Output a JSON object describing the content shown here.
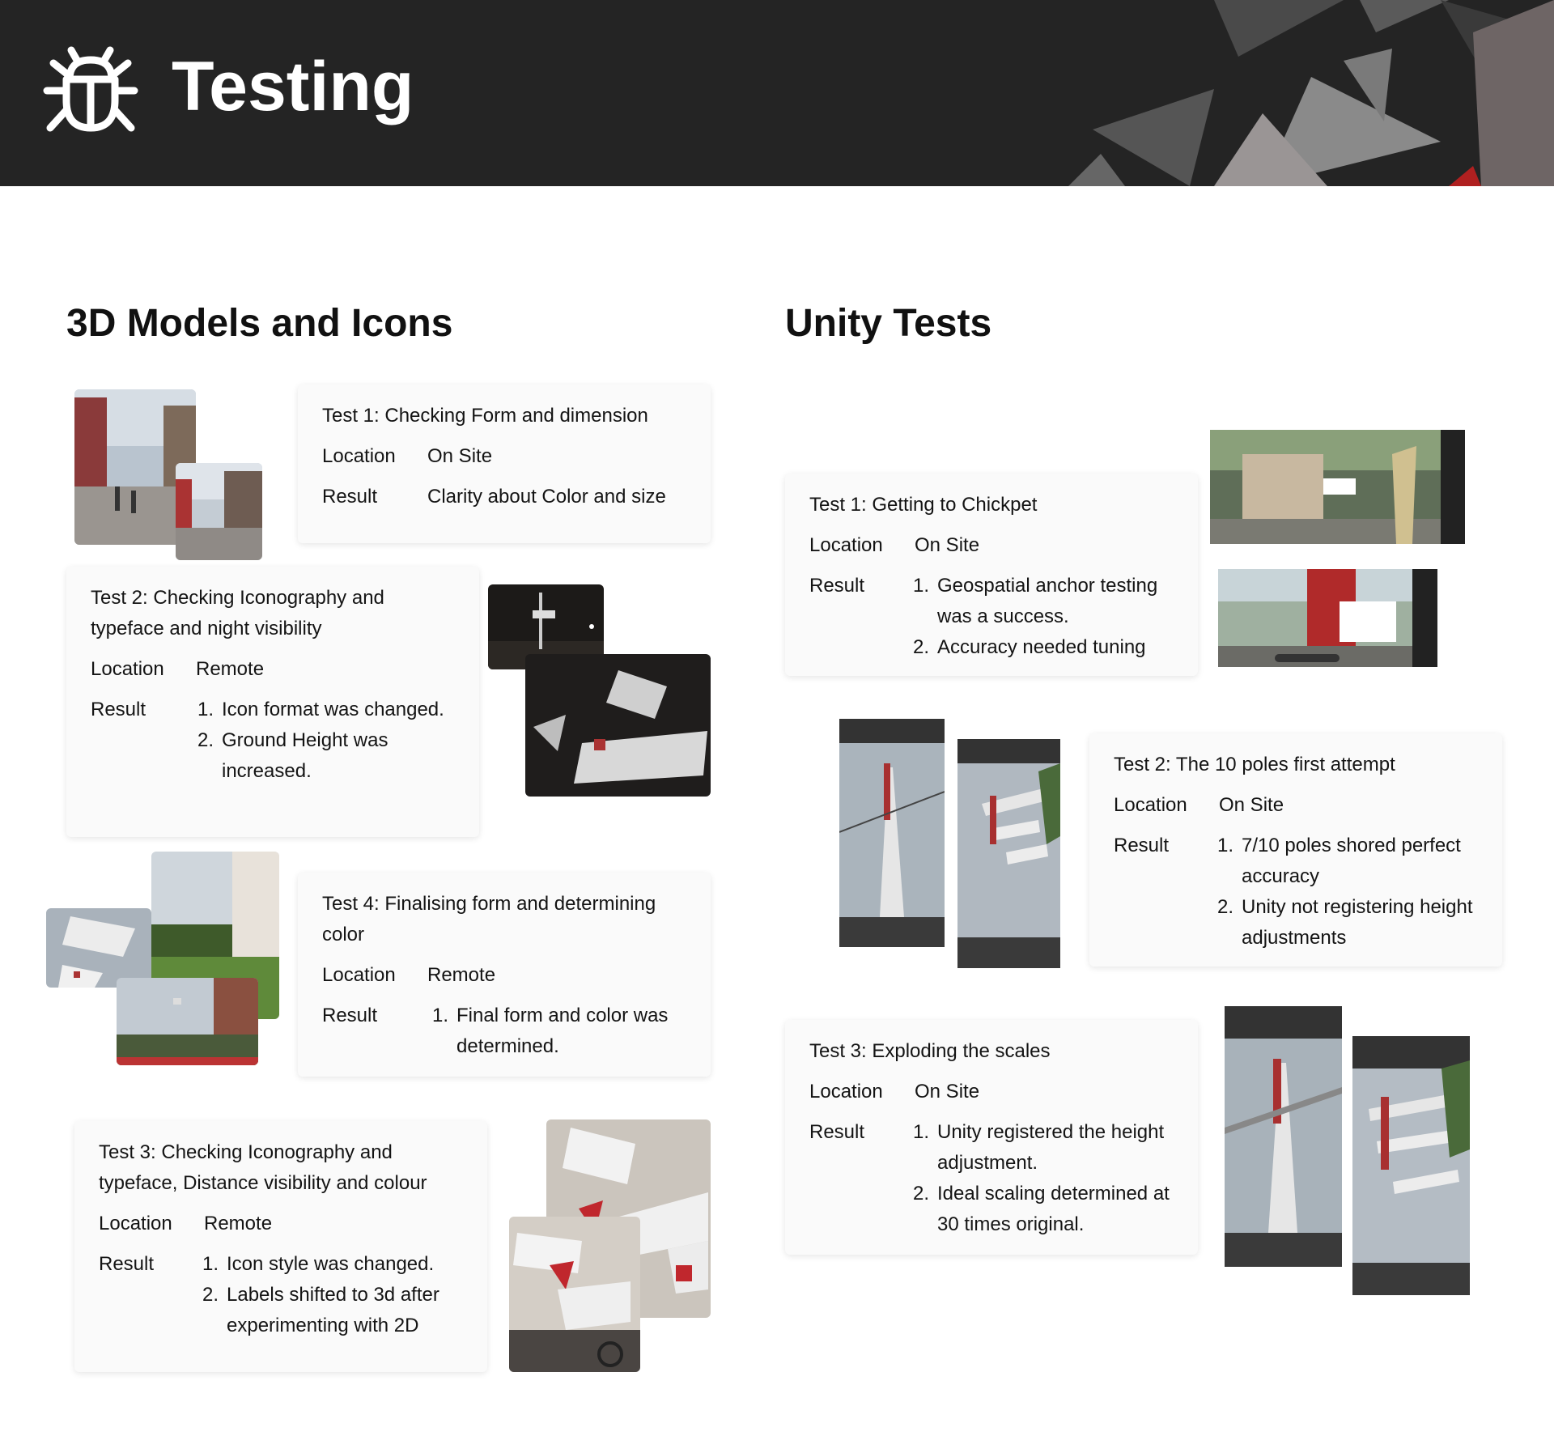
{
  "header": {
    "title": "Testing",
    "icon": "bug-icon"
  },
  "left": {
    "heading": "3D Models and Icons",
    "tests": [
      {
        "title": "Test 1: Checking Form and dimension",
        "location_label": "Location",
        "location": "On Site",
        "result_label": "Result",
        "result": "Clarity about Color and size"
      },
      {
        "title": "Test 2: Checking Iconography and typeface and night visibility",
        "location_label": "Location",
        "location": "Remote",
        "result_label": "Result",
        "results": [
          "Icon format was changed.",
          "Ground Height was increased."
        ]
      },
      {
        "title": "Test 4: Finalising form and determining color",
        "location_label": "Location",
        "location": "Remote",
        "result_label": "Result",
        "results": [
          "Final form and color was determined."
        ]
      },
      {
        "title": "Test 3: Checking Iconography and typeface, Distance visibility and colour",
        "location_label": "Location",
        "location": "Remote",
        "result_label": "Result",
        "results": [
          "Icon style was changed.",
          "Labels shifted to 3d after experimenting with 2D"
        ]
      }
    ]
  },
  "right": {
    "heading": "Unity Tests",
    "tests": [
      {
        "title": "Test 1: Getting to Chickpet",
        "location_label": "Location",
        "location": "On Site",
        "result_label": "Result",
        "results": [
          "Geospatial anchor testing was a success.",
          "Accuracy needed tuning"
        ]
      },
      {
        "title": "Test 2: The 10 poles first attempt",
        "location_label": "Location",
        "location": "On Site",
        "result_label": "Result",
        "results": [
          "7/10 poles shored perfect accuracy",
          "Unity not registering height adjustments"
        ]
      },
      {
        "title": "Test 3: Exploding the scales",
        "location_label": "Location",
        "location": "On Site",
        "result_label": "Result",
        "results": [
          "Unity registered the height adjustment.",
          "Ideal scaling determined at 30 times original."
        ]
      }
    ]
  },
  "colors": {
    "header_bg": "#242424",
    "card_bg": "#fafafa",
    "text": "#141414"
  }
}
